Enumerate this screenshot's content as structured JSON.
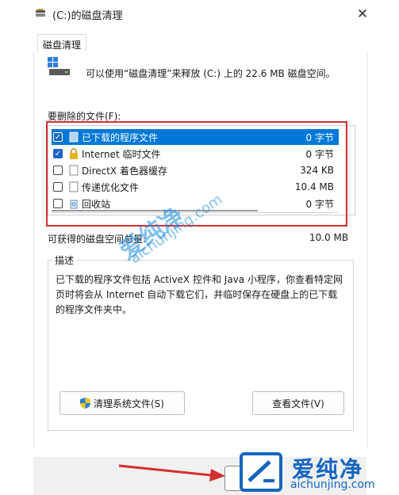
{
  "window": {
    "title": "(C:)的磁盘清理",
    "close_glyph": "✕"
  },
  "tabs": [
    {
      "label": "磁盘清理"
    }
  ],
  "intro_text": "可以使用“磁盘清理”来释放  (C:) 上的 22.6 MB 磁盘空间。",
  "files_label": "要删除的文件(F):",
  "files": [
    {
      "name": "已下载的程序文件",
      "size": "0 字节",
      "checked": true,
      "selected": true,
      "icon": "folder-icon"
    },
    {
      "name": "Internet 临时文件",
      "size": "0 字节",
      "checked": true,
      "selected": false,
      "icon": "lock-icon"
    },
    {
      "name": "DirectX 着色器缓存",
      "size": "324 KB",
      "checked": false,
      "selected": false,
      "icon": "document-icon"
    },
    {
      "name": "传递优化文件",
      "size": "10.4 MB",
      "checked": false,
      "selected": false,
      "icon": "document-icon"
    },
    {
      "name": "回收站",
      "size": "0 字节",
      "checked": false,
      "selected": false,
      "icon": "recycle-bin-icon"
    }
  ],
  "total": {
    "label": "可获得的磁盘空间总量:",
    "value": "10.0 MB"
  },
  "description": {
    "title": "描述",
    "text": "已下载的程序文件包括 ActiveX 控件和 Java 小程序，你查看特定网页时将会从 Internet 自动下载它们，并临时保存在硬盘上的已下载的程序文件夹中。"
  },
  "buttons": {
    "cleanup_system": "清理系统文件(S)",
    "view_files": "查看文件(V)"
  },
  "watermark": {
    "brand": "爱纯净",
    "url": "aichunjing.com"
  },
  "colors": {
    "selection": "#0078d7",
    "annotation": "#d32f2f",
    "brand": "#1565c0"
  }
}
